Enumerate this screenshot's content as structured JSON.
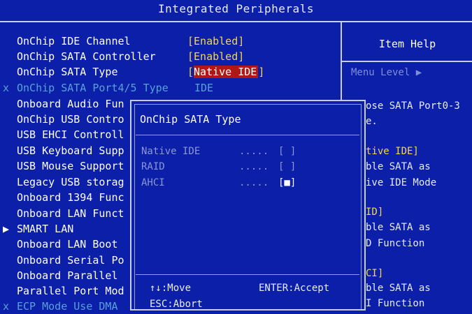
{
  "header": {
    "title": "Integrated Peripherals",
    "top_partial": "—·—"
  },
  "settings": [
    {
      "label": "OnChip IDE Channel",
      "value": "[Enabled]",
      "state": "normal"
    },
    {
      "label": "OnChip SATA Controller",
      "value": "[Enabled]",
      "state": "normal"
    },
    {
      "label": "OnChip SATA Type",
      "value": "Native IDE",
      "state": "selected"
    },
    {
      "label": "OnChip SATA Port4/5 Type",
      "value": "IDE",
      "state": "disabled",
      "marker": "x"
    },
    {
      "label": "Onboard Audio Fun",
      "value": "",
      "state": "normal"
    },
    {
      "label": "OnChip USB Contro",
      "value": "",
      "state": "normal"
    },
    {
      "label": "USB EHCI Controll",
      "value": "",
      "state": "normal"
    },
    {
      "label": "USB Keyboard Supp",
      "value": "",
      "state": "normal"
    },
    {
      "label": "USB Mouse Support",
      "value": "",
      "state": "normal"
    },
    {
      "label": "Legacy USB storag",
      "value": "",
      "state": "normal"
    },
    {
      "label": "Onboard 1394 Func",
      "value": "",
      "state": "normal"
    },
    {
      "label": "Onboard LAN Funct",
      "value": "",
      "state": "normal"
    },
    {
      "label": "SMART LAN",
      "value": "",
      "state": "normal",
      "marker": "▶"
    },
    {
      "label": "Onboard LAN Boot",
      "value": "",
      "state": "normal"
    },
    {
      "label": "Onboard Serial Po",
      "value": "",
      "state": "normal"
    },
    {
      "label": "Onboard Parallel",
      "value": "",
      "state": "normal"
    },
    {
      "label": "Parallel Port Mod",
      "value": "",
      "state": "normal"
    },
    {
      "label": "ECP Mode Use DMA",
      "value": "",
      "state": "disabled",
      "marker": "x"
    }
  ],
  "help": {
    "title": "Item Help",
    "menu_level": "Menu Level   ▶",
    "lines": [
      {
        "text": "ose SATA Port0-3",
        "color": "w"
      },
      {
        "text": "e.",
        "color": "w"
      },
      {
        "text": "tive IDE]",
        "color": "y"
      },
      {
        "text": "ble SATA as",
        "color": "w"
      },
      {
        "text": "ive IDE Mode",
        "color": "w"
      },
      {
        "text": "ID]",
        "color": "y"
      },
      {
        "text": "ble SATA as",
        "color": "w"
      },
      {
        "text": "D Function",
        "color": "w"
      },
      {
        "text": "CI]",
        "color": "y"
      },
      {
        "text": "ble SATA as",
        "color": "w"
      },
      {
        "text": "I Function",
        "color": "w"
      }
    ]
  },
  "popup": {
    "title": "OnChip SATA Type",
    "options": [
      {
        "name": "Native IDE",
        "dots": ".....",
        "box": "[ ]",
        "selected": false
      },
      {
        "name": "RAID",
        "dots": ".....",
        "box": "[ ]",
        "selected": false
      },
      {
        "name": "AHCI",
        "dots": ".....",
        "box": "[■]",
        "selected": true
      }
    ],
    "keys": {
      "move": "↑↓:Move",
      "accept": "ENTER:Accept",
      "abort": "ESC:Abort"
    }
  }
}
